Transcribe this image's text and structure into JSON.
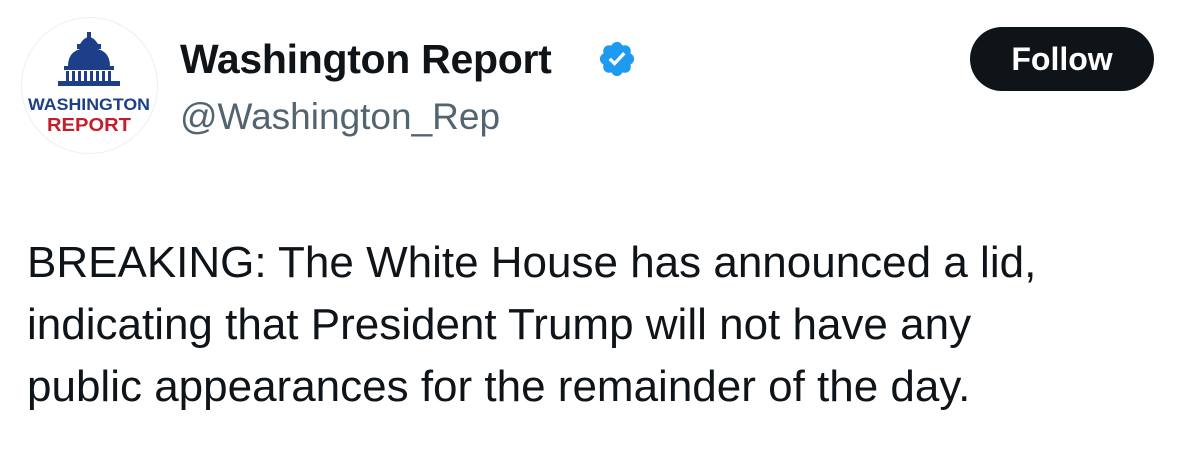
{
  "account": {
    "display_name": "Washington Report",
    "handle": "@Washington_Rep",
    "verified": true,
    "avatar": {
      "icon": "capitol-dome-logo",
      "line1": "WASHINGTON",
      "line2": "REPORT",
      "colors": {
        "blue": "#1d3f8a",
        "red": "#c41e2a"
      }
    }
  },
  "actions": {
    "follow_label": "Follow"
  },
  "tweet": {
    "lines": [
      "BREAKING: The White House has announced a lid,",
      "indicating that President Trump will not have any",
      "public appearances for the remainder of the day."
    ]
  },
  "colors": {
    "text": "#0f1419",
    "secondary_text": "#536471",
    "verified_badge": "#1d9bf0",
    "button_bg": "#0f1419",
    "button_text": "#ffffff"
  }
}
